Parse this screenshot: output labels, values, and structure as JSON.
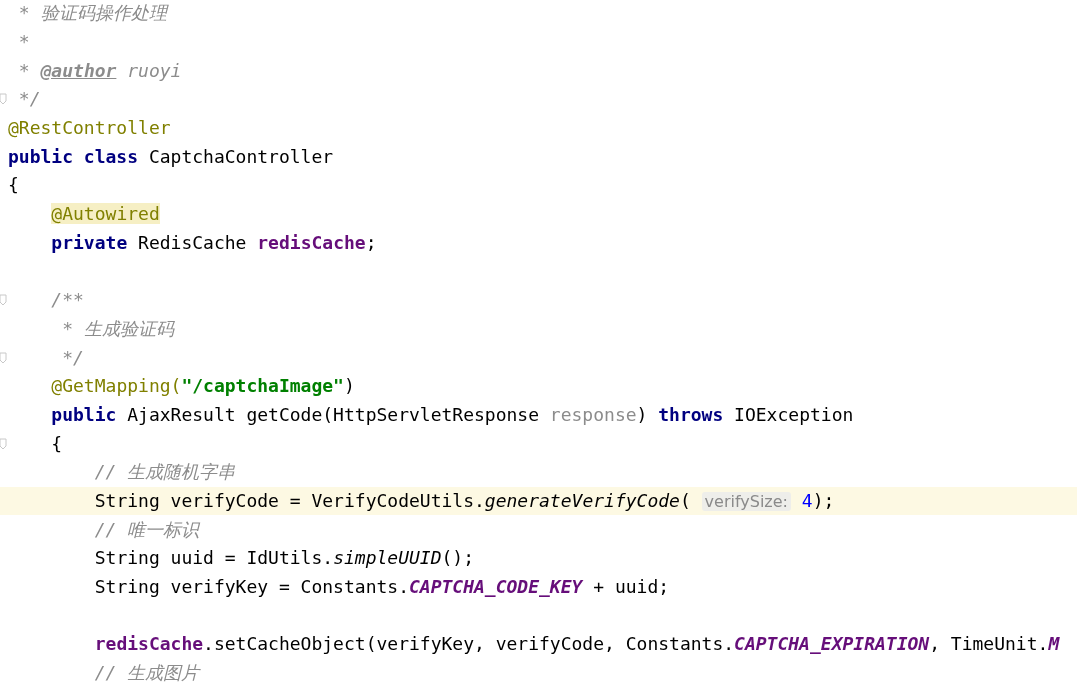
{
  "editor": {
    "lines": [
      {
        "fold": false,
        "current": false,
        "tokens": [
          {
            "kind": "comment",
            "text": " * 验证码操作处理"
          }
        ]
      },
      {
        "fold": false,
        "current": false,
        "tokens": [
          {
            "kind": "comment",
            "text": " *"
          }
        ]
      },
      {
        "fold": false,
        "current": false,
        "tokens": [
          {
            "kind": "comment",
            "text": " * "
          },
          {
            "kind": "doc-tag",
            "text": "@author"
          },
          {
            "kind": "comment",
            "text": " ruoyi"
          }
        ]
      },
      {
        "fold": true,
        "current": false,
        "tokens": [
          {
            "kind": "comment",
            "text": " */"
          }
        ]
      },
      {
        "fold": false,
        "current": false,
        "tokens": [
          {
            "kind": "annotation",
            "text": "@RestController"
          }
        ]
      },
      {
        "fold": false,
        "current": false,
        "tokens": [
          {
            "kind": "keyword",
            "text": "public class "
          },
          {
            "kind": "plain",
            "text": "CaptchaController"
          }
        ]
      },
      {
        "fold": false,
        "current": false,
        "tokens": [
          {
            "kind": "plain",
            "text": "{"
          }
        ]
      },
      {
        "fold": false,
        "current": false,
        "tokens": [
          {
            "kind": "annotation-marked",
            "text": "    @Autowired"
          }
        ]
      },
      {
        "fold": false,
        "current": false,
        "tokens": [
          {
            "kind": "keyword",
            "text": "    private "
          },
          {
            "kind": "plain",
            "text": "RedisCache "
          },
          {
            "kind": "field",
            "text": "redisCache"
          },
          {
            "kind": "plain",
            "text": ";"
          }
        ]
      },
      {
        "fold": false,
        "current": false
      },
      {
        "fold": true,
        "current": false,
        "tokens": [
          {
            "kind": "comment",
            "text": "    /**"
          }
        ]
      },
      {
        "fold": false,
        "current": false,
        "tokens": [
          {
            "kind": "comment",
            "text": "     * 生成验证码"
          }
        ]
      },
      {
        "fold": true,
        "current": false,
        "tokens": [
          {
            "kind": "comment",
            "text": "     */"
          }
        ]
      },
      {
        "fold": false,
        "current": false,
        "tokens": [
          {
            "kind": "annotation",
            "text": "    @GetMapping("
          },
          {
            "kind": "string",
            "text": "\"/captchaImage\""
          },
          {
            "kind": "plain",
            "text": ")"
          }
        ]
      },
      {
        "fold": false,
        "current": false,
        "tokens": [
          {
            "kind": "keyword",
            "text": "    public "
          },
          {
            "kind": "plain",
            "text": "AjaxResult getCode(HttpServletResponse "
          },
          {
            "kind": "param",
            "text": "response"
          },
          {
            "kind": "plain",
            "text": ") "
          },
          {
            "kind": "keyword",
            "text": "throws "
          },
          {
            "kind": "plain",
            "text": "IOException"
          }
        ]
      },
      {
        "fold": true,
        "current": false,
        "tokens": [
          {
            "kind": "plain",
            "text": "    {"
          }
        ]
      },
      {
        "fold": false,
        "current": false,
        "tokens": [
          {
            "kind": "comment",
            "text": "        // 生成随机字串"
          }
        ]
      },
      {
        "fold": false,
        "current": true,
        "tokens": [
          {
            "kind": "plain",
            "text": "        String verifyCode = VerifyCodeUtils."
          },
          {
            "kind": "static-method",
            "text": "generateVerifyCode"
          },
          {
            "kind": "plain",
            "text": "( "
          },
          {
            "kind": "hint",
            "text": "verifySize:"
          },
          {
            "kind": "number",
            "text": " 4"
          },
          {
            "kind": "plain",
            "text": ");"
          }
        ]
      },
      {
        "fold": false,
        "current": false,
        "tokens": [
          {
            "kind": "comment",
            "text": "        // 唯一标识"
          }
        ]
      },
      {
        "fold": false,
        "current": false,
        "tokens": [
          {
            "kind": "plain",
            "text": "        String uuid = IdUtils."
          },
          {
            "kind": "static-method",
            "text": "simpleUUID"
          },
          {
            "kind": "plain",
            "text": "();"
          }
        ]
      },
      {
        "fold": false,
        "current": false,
        "tokens": [
          {
            "kind": "plain",
            "text": "        String verifyKey = Constants."
          },
          {
            "kind": "constant",
            "text": "CAPTCHA_CODE_KEY"
          },
          {
            "kind": "plain",
            "text": " + uuid;"
          }
        ]
      },
      {
        "fold": false,
        "current": false
      },
      {
        "fold": false,
        "current": false,
        "tokens": [
          {
            "kind": "field",
            "text": "        redisCache"
          },
          {
            "kind": "plain",
            "text": ".setCacheObject(verifyKey, verifyCode, Constants."
          },
          {
            "kind": "constant",
            "text": "CAPTCHA_EXPIRATION"
          },
          {
            "kind": "plain",
            "text": ", TimeUnit."
          },
          {
            "kind": "constant",
            "text": "M"
          }
        ]
      },
      {
        "fold": false,
        "current": false,
        "tokens": [
          {
            "kind": "comment",
            "text": "        // 生成图片"
          }
        ]
      }
    ]
  }
}
